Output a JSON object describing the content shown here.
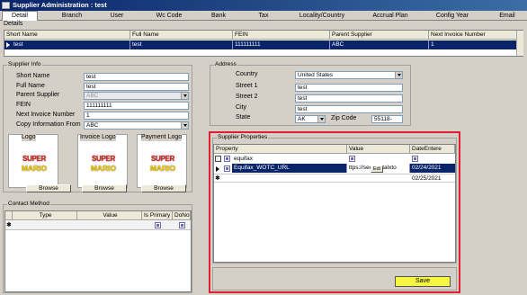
{
  "window": {
    "title": "Supplier Administration : test"
  },
  "tabs": [
    {
      "label": "Detail"
    },
    {
      "label": "Branch"
    },
    {
      "label": "User"
    },
    {
      "label": "Wc Code"
    },
    {
      "label": "Bank"
    },
    {
      "label": "Tax"
    },
    {
      "label": "Locality/Country"
    },
    {
      "label": "Accrual Plan"
    },
    {
      "label": "Config Year"
    },
    {
      "label": "Email"
    }
  ],
  "details": {
    "title": "Details",
    "columns": [
      "Short Name",
      "Full Name",
      "FEIN",
      "Parent Supplier",
      "Next Invoice Number"
    ],
    "rows": [
      {
        "short_name": "test",
        "full_name": "test",
        "fein": "111111111",
        "parent": "ABC",
        "next_invoice": "1"
      }
    ]
  },
  "supplier_info": {
    "title": "Supplier Info",
    "short_name_label": "Short Name",
    "short_name": "test",
    "full_name_label": "Full Name",
    "full_name": "test",
    "parent_label": "Parent Supplier",
    "parent": "ABC",
    "fein_label": "FEIN",
    "fein": "111111111",
    "next_invoice_label": "Next Invoice Number",
    "next_invoice": "1",
    "copy_from_label": "Copy Information From",
    "copy_from": "ABC",
    "logos": [
      {
        "title": "Logo",
        "browse": "Browse"
      },
      {
        "title": "Invoice Logo",
        "browse": "Browse"
      },
      {
        "title": "Payment Logo",
        "browse": "Browse"
      }
    ],
    "logo_text_1": "SUPER",
    "logo_text_2": "MARIO"
  },
  "contact": {
    "title": "Contact Method",
    "columns": [
      "Type",
      "Value",
      "Is Primary",
      "DoNotT"
    ]
  },
  "address": {
    "title": "Address",
    "country_label": "Country",
    "country": "United States",
    "street1_label": "Street 1",
    "street1": "test",
    "street2_label": "Street 2",
    "street2": "test",
    "city_label": "City",
    "city": "test",
    "state_label": "State",
    "state": "AK",
    "zip_label": "Zip Code",
    "zip": "55118-"
  },
  "supplier_properties": {
    "title": "Supplier Properties",
    "columns": [
      "Property",
      "Value",
      "DateEntere"
    ],
    "rows": [
      {
        "property": "equifax",
        "value": "",
        "date": ""
      },
      {
        "property": "Equifax_WOTC_URL",
        "value": "ttps://secure.talxto",
        "date": "02/24/2021"
      },
      {
        "property": "",
        "value": "",
        "date": "02/25/2021"
      }
    ],
    "edit_label": "Edi",
    "save_label": "Save"
  },
  "colors": {
    "title_bar": "#0a246a",
    "selection": "#0a246a",
    "highlight_box": "#e02030",
    "save_button": "#f5f542"
  }
}
